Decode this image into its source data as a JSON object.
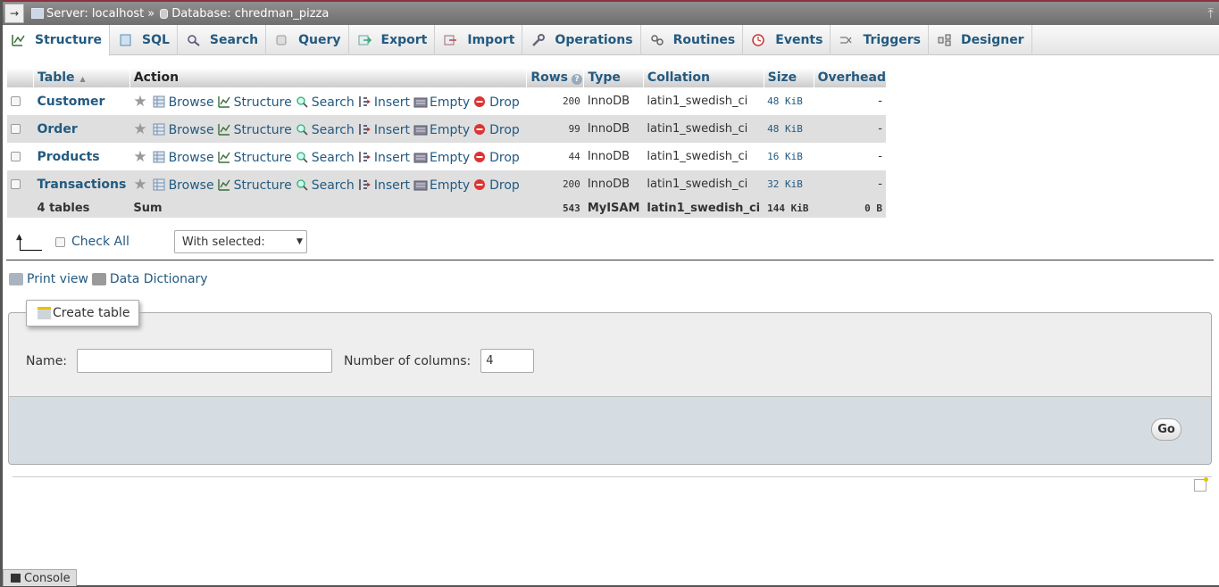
{
  "breadcrumb": {
    "back_label": "→",
    "server": "Server: localhost",
    "separator": "»",
    "database": "Database: chredman_pizza"
  },
  "tabs": [
    {
      "label": "Structure",
      "icon": "structure-icon",
      "active": true
    },
    {
      "label": "SQL",
      "icon": "sql-icon"
    },
    {
      "label": "Search",
      "icon": "search-icon"
    },
    {
      "label": "Query",
      "icon": "query-icon"
    },
    {
      "label": "Export",
      "icon": "export-icon"
    },
    {
      "label": "Import",
      "icon": "import-icon"
    },
    {
      "label": "Operations",
      "icon": "wrench-icon"
    },
    {
      "label": "Routines",
      "icon": "routines-icon"
    },
    {
      "label": "Events",
      "icon": "clock-icon"
    },
    {
      "label": "Triggers",
      "icon": "triggers-icon"
    },
    {
      "label": "Designer",
      "icon": "designer-icon"
    }
  ],
  "table": {
    "headers": {
      "table": "Table",
      "action": "Action",
      "rows": "Rows",
      "type": "Type",
      "collation": "Collation",
      "size": "Size",
      "overhead": "Overhead"
    },
    "actions": {
      "browse": "Browse",
      "structure": "Structure",
      "search": "Search",
      "insert": "Insert",
      "empty": "Empty",
      "drop": "Drop"
    },
    "rows": [
      {
        "name": "Customer",
        "rows": "200",
        "type": "InnoDB",
        "collation": "latin1_swedish_ci",
        "size": "48 KiB",
        "overhead": "-"
      },
      {
        "name": "Order",
        "rows": "99",
        "type": "InnoDB",
        "collation": "latin1_swedish_ci",
        "size": "48 KiB",
        "overhead": "-"
      },
      {
        "name": "Products",
        "rows": "44",
        "type": "InnoDB",
        "collation": "latin1_swedish_ci",
        "size": "16 KiB",
        "overhead": "-"
      },
      {
        "name": "Transactions",
        "rows": "200",
        "type": "InnoDB",
        "collation": "latin1_swedish_ci",
        "size": "32 KiB",
        "overhead": "-"
      }
    ],
    "footer": {
      "count": "4 tables",
      "sum": "Sum",
      "rows": "543",
      "type": "MyISAM",
      "collation": "latin1_swedish_ci",
      "size": "144 KiB",
      "overhead": "0 B"
    }
  },
  "bulk": {
    "check_all": "Check All",
    "with_selected": "With selected:"
  },
  "links": {
    "print_view": "Print view",
    "data_dictionary": "Data Dictionary"
  },
  "create_table": {
    "legend": "Create table",
    "name_label": "Name:",
    "name_value": "",
    "columns_label": "Number of columns:",
    "columns_value": "4",
    "go": "Go"
  },
  "console": {
    "label": "Console"
  }
}
